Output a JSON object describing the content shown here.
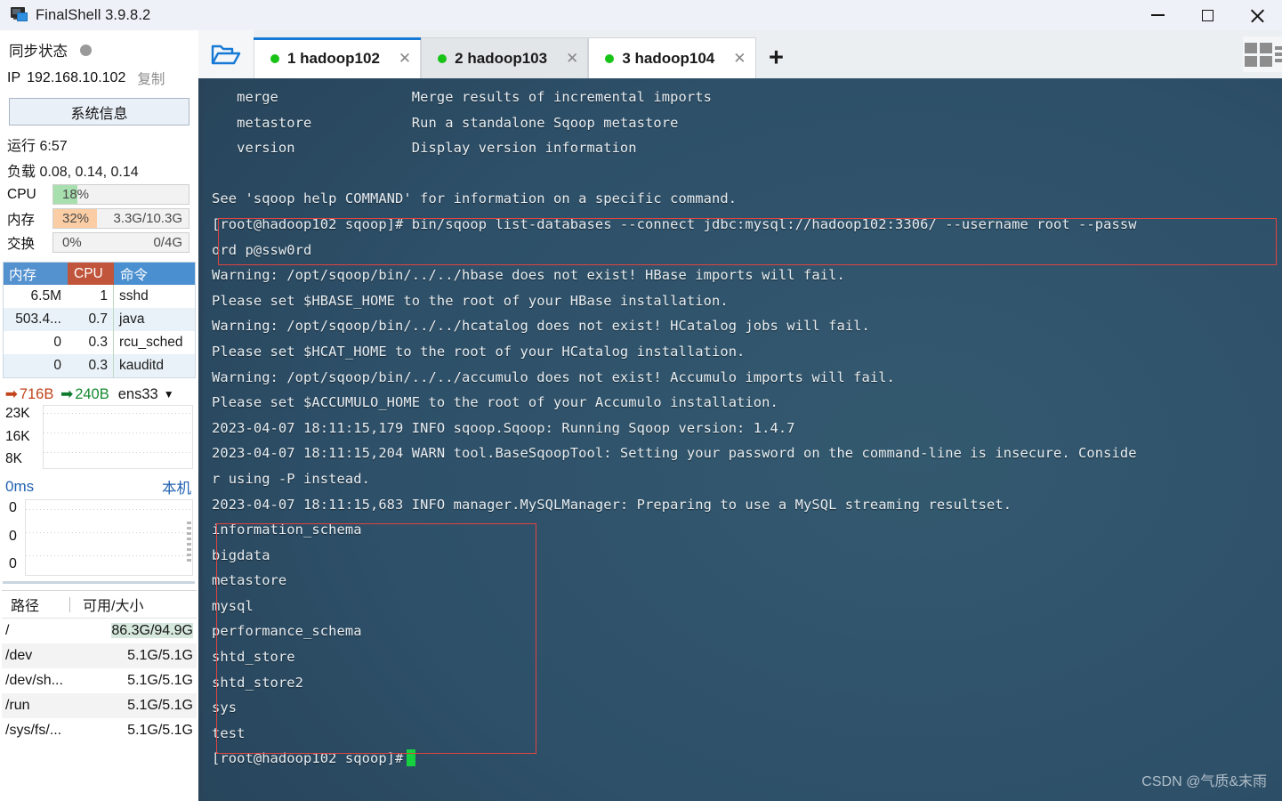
{
  "window": {
    "title": "FinalShell 3.9.8.2",
    "logo_icon": "monitor-icon",
    "minimize_label": "—",
    "maximize_label": "□",
    "close_label": "✕"
  },
  "sidebar": {
    "sync": {
      "label": "同步状态",
      "status_icon": "status-dot-idle"
    },
    "ip": {
      "label": "IP",
      "value": "192.168.10.102",
      "copy_label": "复制"
    },
    "sysinfo_button": "系统信息",
    "uptime": {
      "label": "运行",
      "value": "6:57"
    },
    "load": {
      "label": "负载",
      "value": "0.08, 0.14, 0.14"
    },
    "meters": [
      {
        "name": "CPU",
        "pct": "18%",
        "fill_pct": 18,
        "extra": "",
        "color": "#a8dfae"
      },
      {
        "name": "内存",
        "pct": "32%",
        "fill_pct": 32,
        "extra": "3.3G/10.3G",
        "color": "#fbcda4"
      },
      {
        "name": "交换",
        "pct": "0%",
        "fill_pct": 0,
        "extra": "0/4G",
        "color": "#cccccc"
      }
    ],
    "process_table": {
      "headers": {
        "mem": "内存",
        "cpu": "CPU",
        "cmd": "命令"
      },
      "rows": [
        {
          "mem": "6.5M",
          "cpu": "1",
          "cmd": "sshd"
        },
        {
          "mem": "503.4...",
          "cpu": "0.7",
          "cmd": "java"
        },
        {
          "mem": "0",
          "cpu": "0.3",
          "cmd": "rcu_sched"
        },
        {
          "mem": "0",
          "cpu": "0.3",
          "cmd": "kauditd"
        }
      ]
    },
    "network": {
      "up_icon": "arrow-up-icon",
      "up_value": "716B",
      "down_icon": "arrow-down-icon",
      "down_value": "240B",
      "interface": "ens33",
      "caret_icon": "chevron-down-icon",
      "axis": [
        "23K",
        "16K",
        "8K"
      ]
    },
    "ping": {
      "latency": "0ms",
      "host": "本机",
      "axis": [
        "0",
        "0",
        "0"
      ]
    },
    "disk_table": {
      "headers": {
        "path": "路径",
        "size": "可用/大小"
      },
      "rows": [
        {
          "path": "/",
          "size": "86.3G/94.9G",
          "highlight": true
        },
        {
          "path": "/dev",
          "size": "5.1G/5.1G",
          "highlight": false
        },
        {
          "path": "/dev/sh...",
          "size": "5.1G/5.1G",
          "highlight": false
        },
        {
          "path": "/run",
          "size": "5.1G/5.1G",
          "highlight": false
        },
        {
          "path": "/sys/fs/...",
          "size": "5.1G/5.1G",
          "highlight": false
        }
      ]
    }
  },
  "tabbar": {
    "folder_icon": "open-folder-icon",
    "tabs": [
      {
        "label": "1 hadoop102",
        "state": "active",
        "dot": "connected",
        "close_label": "✕"
      },
      {
        "label": "2 hadoop103",
        "state": "inactive",
        "dot": "connected",
        "close_label": "✕"
      },
      {
        "label": "3 hadoop104",
        "state": "inactive-plain",
        "dot": "connected",
        "close_label": "✕"
      }
    ],
    "add_label": "+",
    "layout_icon": "layout-grid-icon"
  },
  "terminal": {
    "lines": [
      "   merge                Merge results of incremental imports",
      "   metastore            Run a standalone Sqoop metastore",
      "   version              Display version information",
      "",
      "See 'sqoop help COMMAND' for information on a specific command.",
      "[root@hadoop102 sqoop]# bin/sqoop list-databases --connect jdbc:mysql://hadoop102:3306/ --username root --passw",
      "ord p@ssw0rd",
      "Warning: /opt/sqoop/bin/../../hbase does not exist! HBase imports will fail.",
      "Please set $HBASE_HOME to the root of your HBase installation.",
      "Warning: /opt/sqoop/bin/../../hcatalog does not exist! HCatalog jobs will fail.",
      "Please set $HCAT_HOME to the root of your HCatalog installation.",
      "Warning: /opt/sqoop/bin/../../accumulo does not exist! Accumulo imports will fail.",
      "Please set $ACCUMULO_HOME to the root of your Accumulo installation.",
      "2023-04-07 18:11:15,179 INFO sqoop.Sqoop: Running Sqoop version: 1.4.7",
      "2023-04-07 18:11:15,204 WARN tool.BaseSqoopTool: Setting your password on the command-line is insecure. Conside",
      "r using -P instead.",
      "2023-04-07 18:11:15,683 INFO manager.MySQLManager: Preparing to use a MySQL streaming resultset.",
      "information_schema",
      "bigdata",
      "metastore",
      "mysql",
      "performance_schema",
      "shtd_store",
      "shtd_store2",
      "sys",
      "test"
    ],
    "prompt": "[root@hadoop102 sqoop]#",
    "cursor": "block-cursor",
    "colors": {
      "background": "#2e5069",
      "foreground": "#e8eef2",
      "cursor": "#16d13f",
      "highlight_box": "#e2433f"
    }
  },
  "watermark": "CSDN @气质&末雨"
}
